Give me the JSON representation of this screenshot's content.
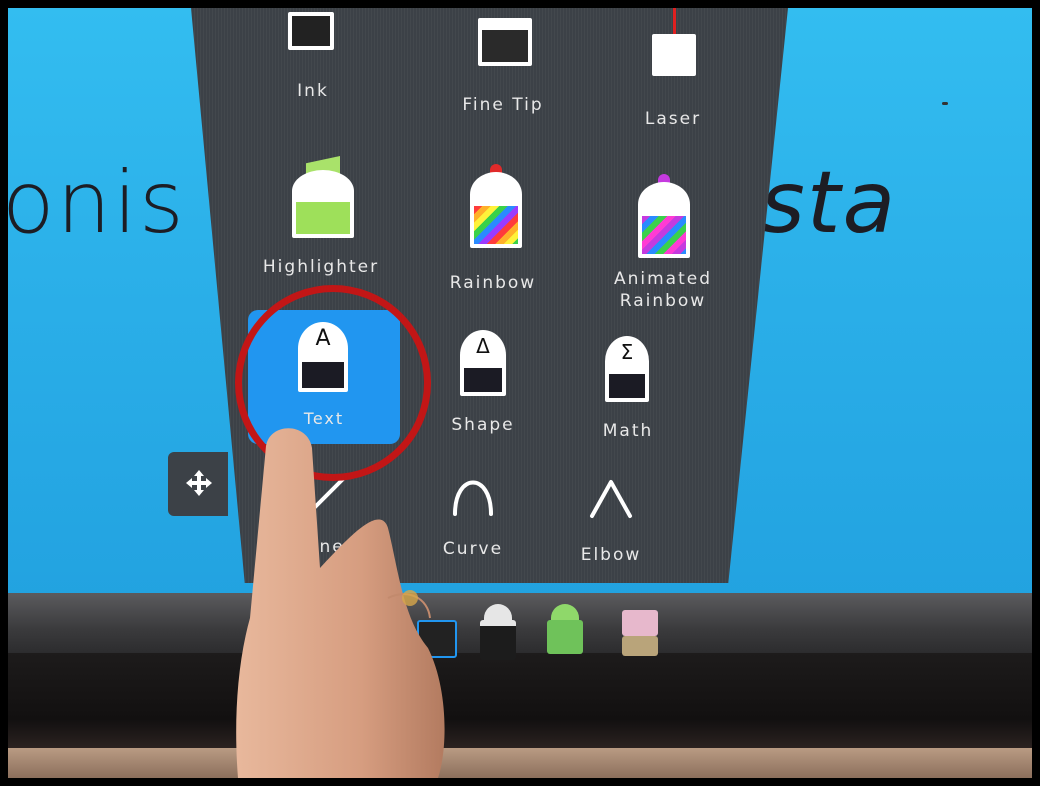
{
  "background_text": {
    "left": "onis",
    "right": "sta"
  },
  "tools": [
    {
      "id": "ink",
      "label": "Ink"
    },
    {
      "id": "fine-tip",
      "label": "Fine Tip"
    },
    {
      "id": "laser",
      "label": "Laser"
    },
    {
      "id": "highlighter",
      "label": "Highlighter"
    },
    {
      "id": "rainbow",
      "label": "Rainbow"
    },
    {
      "id": "animated-rainbow",
      "label": "Animated\nRainbow"
    },
    {
      "id": "text",
      "label": "Text",
      "selected": true,
      "glyph": "A"
    },
    {
      "id": "shape",
      "label": "Shape",
      "glyph": "Δ"
    },
    {
      "id": "math",
      "label": "Math",
      "glyph": "Σ"
    },
    {
      "id": "line",
      "label": "Line"
    },
    {
      "id": "curve",
      "label": "Curve"
    },
    {
      "id": "elbow",
      "label": "Elbow"
    }
  ],
  "colors": {
    "screen": "#2aaee8",
    "panel": "#3c4147",
    "selected": "#2196f0",
    "highlighter": "#9ee05a",
    "annotation": "#c21616"
  },
  "icons": {
    "move": "move-icon",
    "curve": "curve-icon",
    "elbow": "elbow-icon",
    "line": "line-icon"
  }
}
